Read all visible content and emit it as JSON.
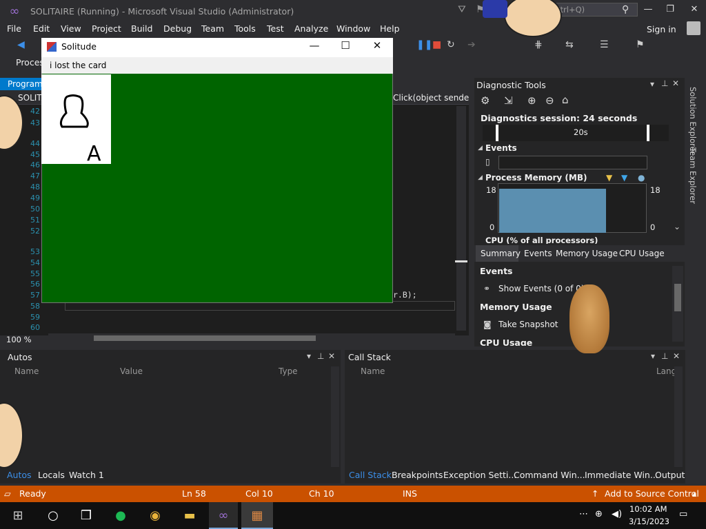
{
  "window": {
    "title": "SOLITAIRE (Running) - Microsoft Visual Studio  (Administrator)",
    "quick_launch_placeholder": "(Ctrl+Q)"
  },
  "menu": [
    "File",
    "Edit",
    "View",
    "Project",
    "Build",
    "Debug",
    "Team",
    "Tools",
    "Test",
    "Analyze",
    "Window",
    "Help"
  ],
  "sign_in": "Sign in",
  "toolbar": {
    "process_label": "Proces"
  },
  "editor": {
    "doc_tab": "Program.",
    "nav_class": "SOLITA",
    "nav_method": "Click(object sende",
    "line_numbers": [
      "42",
      "43",
      "44",
      "45",
      "46",
      "47",
      "48",
      "49",
      "50",
      "51",
      "52",
      "53",
      "54",
      "55",
      "56",
      "57",
      "58",
      "59",
      "60"
    ],
    "code_fragment": "r.B);",
    "zoom": "100 %"
  },
  "solitude": {
    "title": "Solitude",
    "menu_text": "i lost the card",
    "card_rank": "A"
  },
  "diagnostics": {
    "title": "Diagnostic Tools",
    "session": "Diagnostics session: 24 seconds",
    "timeline_label": "20s",
    "events_header": "Events",
    "memory_header": "Process Memory (MB)",
    "memory_max": "18",
    "memory_min": "0",
    "memory_level": 0.72,
    "cpu_header": "CPU (% of all processors)",
    "tabs": [
      "Summary",
      "Events",
      "Memory Usage",
      "CPU Usage"
    ],
    "summary": {
      "events_h": "Events",
      "show_events": "Show Events (0 of 0)",
      "memory_h": "Memory Usage",
      "take_snapshot": "Take Snapshot",
      "cpu_h": "CPU Usage"
    }
  },
  "side_panels": [
    "Solution Explorer",
    "Team Explorer"
  ],
  "autos": {
    "title": "Autos",
    "columns": [
      "Name",
      "Value",
      "Type"
    ],
    "tabs": [
      "Autos",
      "Locals",
      "Watch 1"
    ]
  },
  "callstack": {
    "title": "Call Stack",
    "columns": [
      "Name",
      "Lang"
    ],
    "tabs": [
      "Call Stack",
      "Breakpoints",
      "Exception Setti...",
      "Command Win...",
      "Immediate Win...",
      "Output"
    ]
  },
  "status": {
    "ready": "Ready",
    "ln": "Ln 58",
    "col": "Col 10",
    "ch": "Ch 10",
    "mode": "INS",
    "source_control": "Add to Source Control"
  },
  "taskbar": {
    "time": "10:02 AM",
    "date": "3/15/2023"
  }
}
